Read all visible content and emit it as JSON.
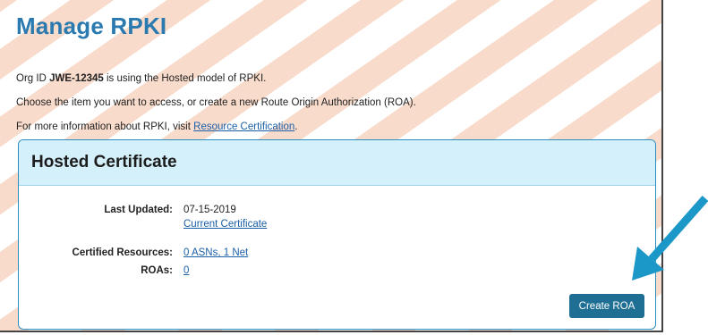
{
  "page": {
    "title": "Manage RPKI",
    "intro_prefix": "Org ID ",
    "org_id": "JWE-12345",
    "intro_suffix": " is using the Hosted model of RPKI.",
    "choose_text": "Choose the item you want to access, or create a new Route Origin Authorization (ROA).",
    "more_info_prefix": "For more information about RPKI, visit ",
    "more_info_link": "Resource Certification",
    "more_info_suffix": "."
  },
  "card": {
    "title": "Hosted Certificate",
    "last_updated_label": "Last Updated:",
    "last_updated_value": "07-15-2019",
    "current_certificate_link": "Current Certificate",
    "certified_resources_label": "Certified Resources:",
    "certified_resources_link": "0 ASNs, 1 Net",
    "roas_label": "ROAs:",
    "roas_link": "0",
    "create_roa_button": "Create ROA"
  },
  "colors": {
    "title": "#2a7ab0",
    "stripe": "#f8d3c0",
    "card_header": "#d4f0fa",
    "card_border": "#2a8fc0",
    "button": "#1f6f94",
    "arrow": "#1b97c8"
  },
  "icons": {
    "pointer_arrow": "arrow-pointing-down-left-icon"
  }
}
